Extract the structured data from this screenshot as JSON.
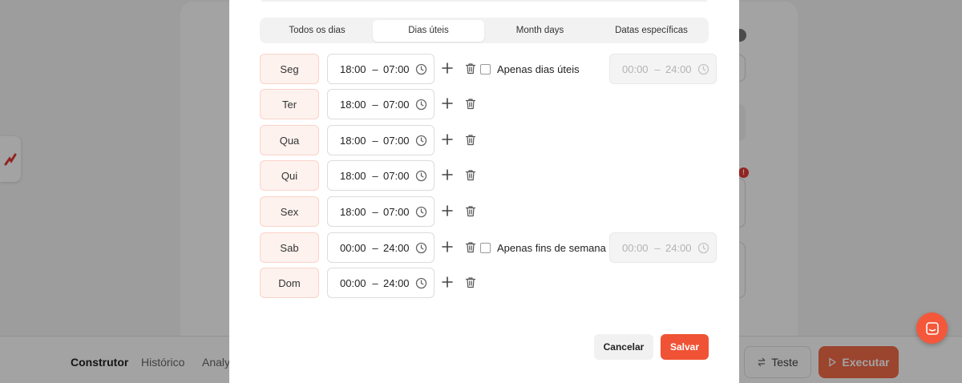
{
  "background": {
    "tabs": [
      "Construtor",
      "Histórico",
      "Analyt"
    ],
    "test_label": "Teste",
    "run_label": "Executar",
    "alert_mark": "!"
  },
  "modal": {
    "filter_tabs": [
      "Todos os dias",
      "Dias úteis",
      "Month days",
      "Datas específicas"
    ],
    "active_tab": "Dias úteis",
    "days": [
      {
        "label": "Seg",
        "start": "18:00",
        "end": "07:00",
        "checkbox_label": "Apenas dias úteis",
        "extra_start": "00:00",
        "extra_end": "24:00"
      },
      {
        "label": "Ter",
        "start": "18:00",
        "end": "07:00"
      },
      {
        "label": "Qua",
        "start": "18:00",
        "end": "07:00"
      },
      {
        "label": "Qui",
        "start": "18:00",
        "end": "07:00"
      },
      {
        "label": "Sex",
        "start": "18:00",
        "end": "07:00"
      },
      {
        "label": "Sab",
        "start": "00:00",
        "end": "24:00",
        "checkbox_label": "Apenas fins de semana",
        "extra_start": "00:00",
        "extra_end": "24:00"
      },
      {
        "label": "Dom",
        "start": "00:00",
        "end": "24:00"
      }
    ],
    "range_separator": "–",
    "cancel_label": "Cancelar",
    "save_label": "Salvar"
  },
  "colors": {
    "accent": "#f05235",
    "day_bg": "#fdf2ee",
    "day_border": "#fbd3c8"
  },
  "icons": [
    "clock-icon",
    "plus-icon",
    "trash-icon",
    "chat-icon",
    "swap-icon",
    "play-icon",
    "logo-icon"
  ]
}
